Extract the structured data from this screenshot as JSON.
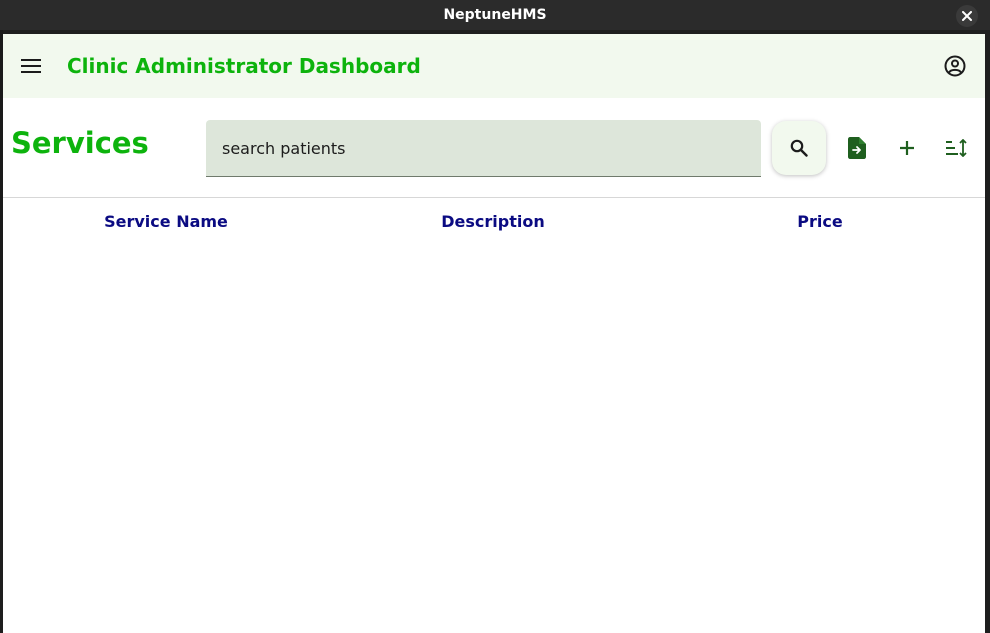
{
  "window": {
    "title": "NeptuneHMS"
  },
  "appbar": {
    "title": "Clinic Administrator Dashboard"
  },
  "page": {
    "title": "Services"
  },
  "search": {
    "value": "search patients"
  },
  "table": {
    "columns": [
      "Service Name",
      "Description",
      "Price"
    ],
    "rows": []
  },
  "colors": {
    "accent": "#0db30d",
    "header_text": "#0b0b82",
    "appbar_bg": "#f2f9ee",
    "search_bg": "#dde6da"
  }
}
